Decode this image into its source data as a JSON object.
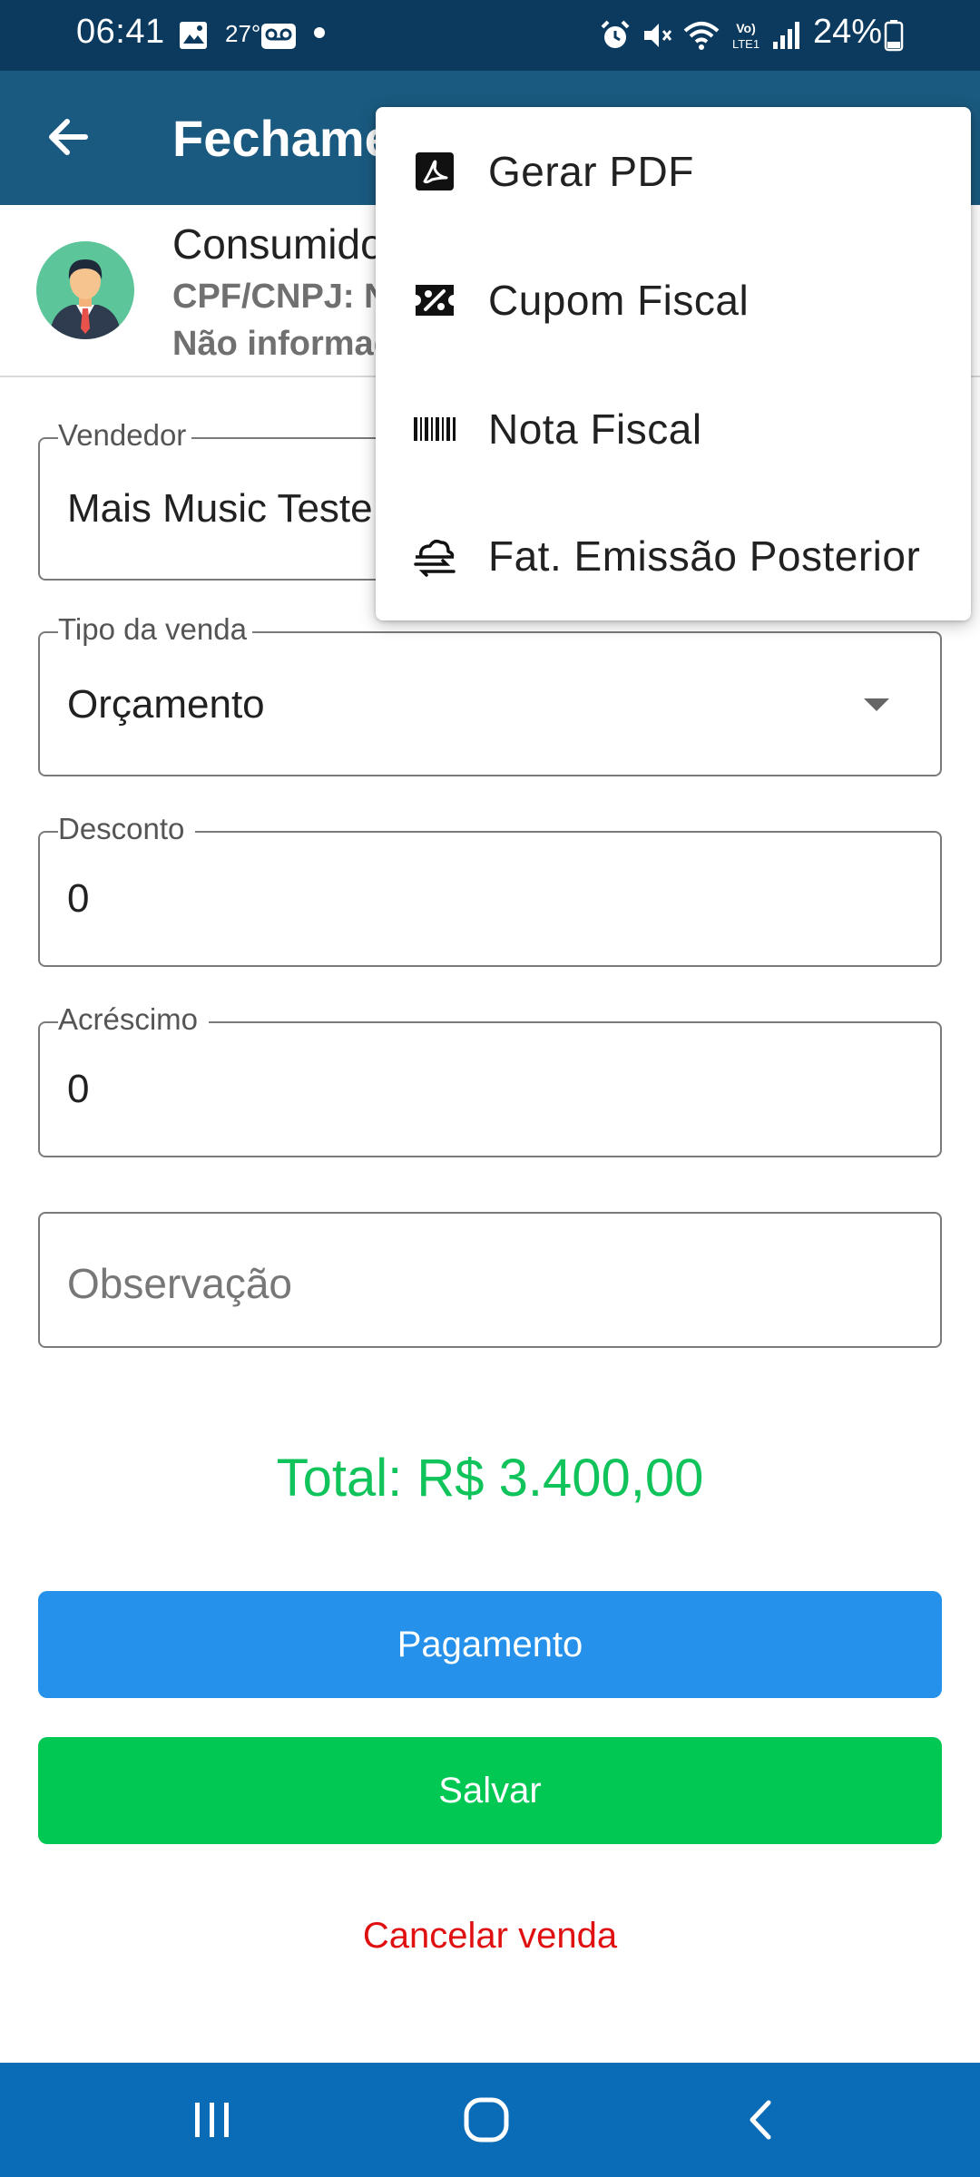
{
  "status_bar": {
    "time": "06:41",
    "temperature": "27°",
    "battery": "24%"
  },
  "app_bar": {
    "title": "Fechamento"
  },
  "customer": {
    "name": "Consumidor",
    "doc": "CPF/CNPJ: Não informado",
    "info": "Não informado"
  },
  "form": {
    "seller": {
      "label": "Vendedor",
      "value": "Mais Music Teste"
    },
    "sale_type": {
      "label": "Tipo da venda",
      "value": "Orçamento"
    },
    "discount": {
      "label": "Desconto",
      "value": "0"
    },
    "surcharge": {
      "label": "Acréscimo",
      "value": "0"
    },
    "note": {
      "placeholder": "Observação"
    }
  },
  "total": "Total: R$ 3.400,00",
  "buttons": {
    "payment": "Pagamento",
    "save": "Salvar",
    "cancel": "Cancelar venda"
  },
  "menu": {
    "items": [
      {
        "label": "Gerar PDF",
        "icon": "pdf-icon"
      },
      {
        "label": "Cupom Fiscal",
        "icon": "coupon-percent-icon"
      },
      {
        "label": "Nota Fiscal",
        "icon": "barcode-icon"
      },
      {
        "label": "Fat. Emissão Posterior",
        "icon": "cloud-sync-icon"
      }
    ]
  },
  "colors": {
    "status_bar": "#0b3a5e",
    "app_bar": "#1a5a80",
    "payment_button": "#2591ea",
    "save_button": "#00c853",
    "total_text": "#10c35a",
    "cancel_text": "#e01010",
    "nav_bar": "#0a6bb7"
  }
}
